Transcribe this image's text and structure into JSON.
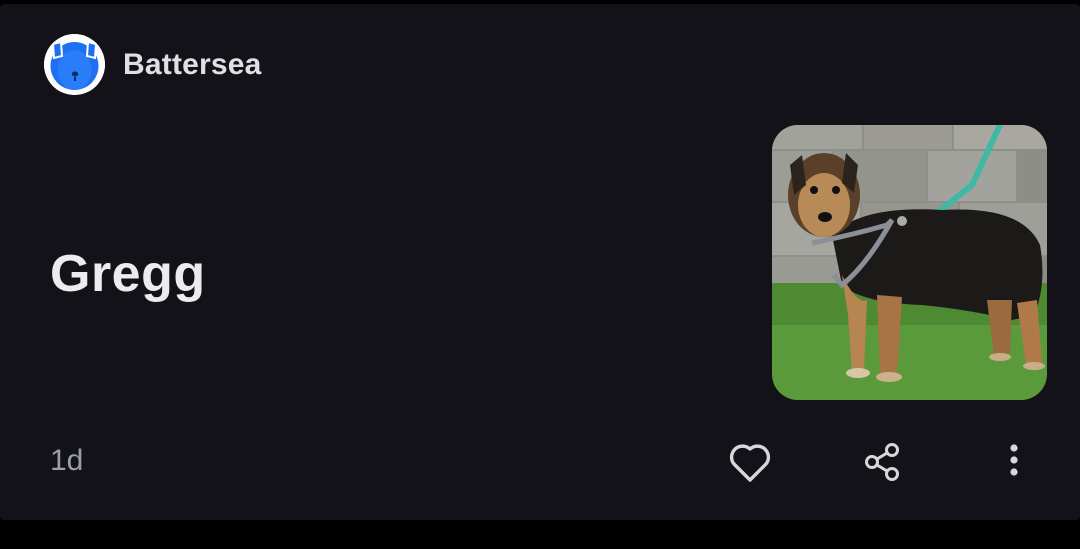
{
  "card": {
    "source": {
      "name": "Battersea",
      "logo_icon": "battersea-dog-logo-icon"
    },
    "headline": "Gregg",
    "thumbnail_icon": "dog-photo",
    "timestamp": "1d",
    "actions": {
      "like_icon": "heart-outline-icon",
      "share_icon": "share-icon",
      "more_icon": "more-vertical-icon"
    }
  },
  "colors": {
    "background": "#121218",
    "text_primary": "#ececef",
    "text_secondary": "#9aa0a8",
    "logo_blue": "#1f6ff2"
  }
}
